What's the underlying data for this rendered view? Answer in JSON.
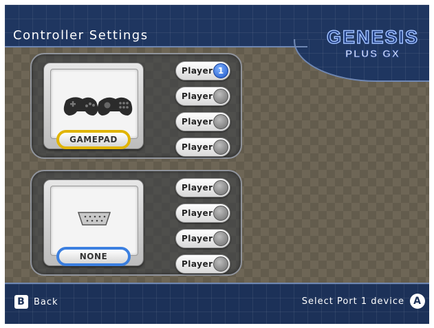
{
  "header": {
    "title": "Controller Settings",
    "logo_line1": "GENESIS",
    "logo_line2": "PLUS GX"
  },
  "ports": [
    {
      "device_label": "GAMEPAD",
      "device_icon": "genesis-gamepad-icon",
      "players": [
        {
          "label": "Player",
          "number": "1",
          "active": true
        },
        {
          "label": "Player",
          "number": "",
          "active": false
        },
        {
          "label": "Player",
          "number": "",
          "active": false
        },
        {
          "label": "Player",
          "number": "",
          "active": false
        }
      ]
    },
    {
      "device_label": "NONE",
      "device_icon": "db9-port-icon",
      "players": [
        {
          "label": "Player",
          "number": "",
          "active": false
        },
        {
          "label": "Player",
          "number": "",
          "active": false
        },
        {
          "label": "Player",
          "number": "",
          "active": false
        },
        {
          "label": "Player",
          "number": "",
          "active": false
        }
      ]
    }
  ],
  "footer": {
    "back_key": "B",
    "back_label": "Back",
    "action_label": "Select Port 1 device",
    "action_key": "A"
  },
  "colors": {
    "header_blue": "#1f3660",
    "selected_outline": "#e1b400",
    "port2_outline": "#3b7fe0",
    "active_player": "#1c55c8"
  }
}
